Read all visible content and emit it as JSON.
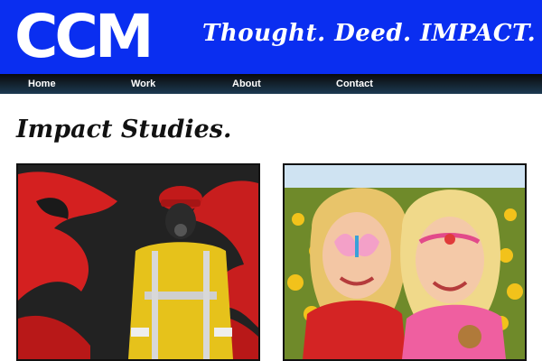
{
  "brand": {
    "logo": "CCM",
    "tagline": "Thought. Deed. IMPACT."
  },
  "nav": [
    {
      "label": "Home"
    },
    {
      "label": "Work"
    },
    {
      "label": "About"
    },
    {
      "label": "Contact"
    }
  ],
  "section": {
    "heading": "Impact Studies."
  },
  "colors": {
    "brand_blue": "#0a2ef0",
    "nav_dark": "#0a0a0a"
  },
  "thumbnails": [
    {
      "subject": "firefighter in turnout gear with red dragon background"
    },
    {
      "subject": "two children with face paint in sunflower field"
    }
  ]
}
